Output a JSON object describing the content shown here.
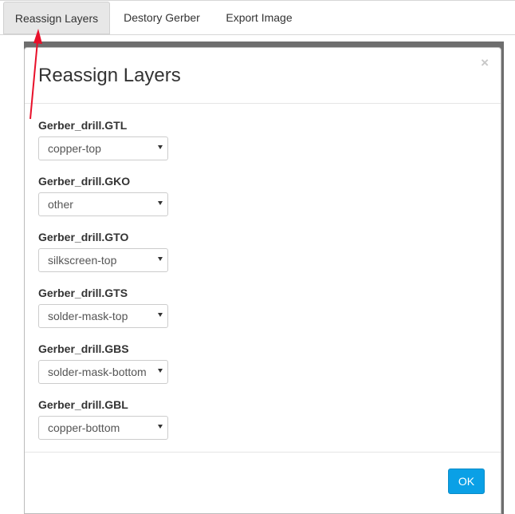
{
  "tabs": [
    {
      "label": "Reassign Layers",
      "active": true
    },
    {
      "label": "Destory Gerber",
      "active": false
    },
    {
      "label": "Export Image",
      "active": false
    }
  ],
  "modal": {
    "title": "Reassign Layers",
    "close_symbol": "×",
    "fields": [
      {
        "label": "Gerber_drill.GTL",
        "value": "copper-top"
      },
      {
        "label": "Gerber_drill.GKO",
        "value": "other"
      },
      {
        "label": "Gerber_drill.GTO",
        "value": "silkscreen-top"
      },
      {
        "label": "Gerber_drill.GTS",
        "value": "solder-mask-top"
      },
      {
        "label": "Gerber_drill.GBS",
        "value": "solder-mask-bottom"
      },
      {
        "label": "Gerber_drill.GBL",
        "value": "copper-bottom"
      }
    ],
    "ok_label": "OK"
  },
  "icons": {
    "close": "close-icon",
    "dropdown": "chevron-down-icon",
    "annotation": "arrow-annotation-icon"
  },
  "colors": {
    "accent": "#0aa0e6",
    "annotation": "#e8102a",
    "backdrop": "#6e6e6e"
  }
}
